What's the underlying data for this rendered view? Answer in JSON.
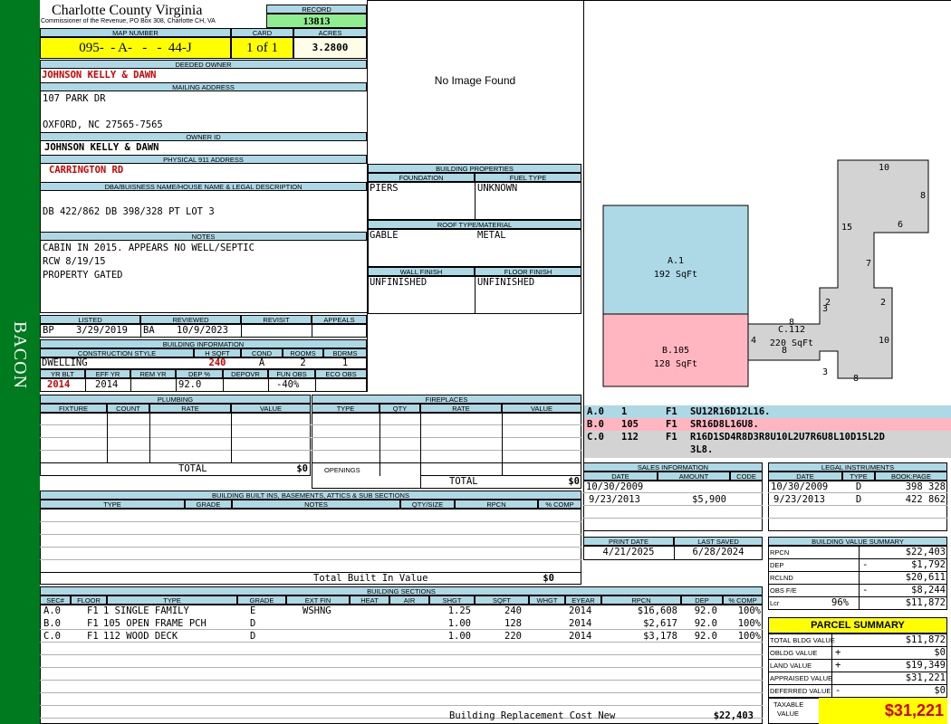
{
  "sidebar": {
    "label": "BACON",
    "color": "#007a1f"
  },
  "header": {
    "county": "Charlotte County Virginia",
    "commissioner": "Commissioner of the Revenue, PO Box 308, Charlotte CH, VA",
    "record_label": "RECORD",
    "record": "13813",
    "map_label": "MAP NUMBER",
    "map_number": "095-  - A-   -   -  44-J",
    "card_label": "CARD",
    "card": "1 of 1",
    "acres_label": "ACRES",
    "acres": "3.2800"
  },
  "owner": {
    "deeded_label": "DEEDED OWNER",
    "deeded": "JOHNSON KELLY & DAWN",
    "mailing_label": "MAILING ADDRESS",
    "mail1": "107 PARK DR",
    "mail2": "OXFORD, NC 27565-7565",
    "owner_id_label": "OWNER ID",
    "owner_id": "JOHNSON KELLY & DAWN",
    "phys_label": "PHYSICAL 911 ADDRESS",
    "phys": "CARRINGTON RD",
    "legal_label": "DBA/BUISNESS NAME/HOUSE NAME & LEGAL DESCRIPTION",
    "legal": "DB 422/862 DB 398/328 PT LOT 3",
    "notes_label": "NOTES",
    "notes": [
      "CABIN IN 2015.  APPEARS NO WELL/SEPTIC",
      "RCW 8/19/15",
      "PROPERTY GATED"
    ]
  },
  "listing": {
    "listed_label": "LISTED",
    "reviewed_label": "REVIEWED",
    "revisit_label": "REVISIT",
    "appeals_label": "APPEALS",
    "listed_by": "BP",
    "listed_date": "3/29/2019",
    "reviewed_by": "BA",
    "reviewed_date": "10/9/2023"
  },
  "building_info": {
    "title": "BUILDING INFORMATION",
    "h_style": "CONSTRUCTION STYLE",
    "h_sqft": "H SQFT",
    "h_cond": "COND",
    "h_rooms": "ROOMS",
    "h_bdrms": "BDRMS",
    "style": "DWELLING",
    "sqft": "240",
    "cond": "A",
    "rooms": "2",
    "bdrms": "1",
    "h_yrblt": "YR BLT",
    "h_effyr": "EFF YR",
    "h_remyr": "REM YR",
    "h_dep": "DEP %",
    "h_depovr": "DEPOVR",
    "h_funobs": "FUN OBS",
    "h_ecoobs": "ECO OBS",
    "yrblt": "2014",
    "effyr": "2014",
    "dep": "92.0",
    "funobs": "-40%"
  },
  "plumbing": {
    "title": "PLUMBING",
    "h_fixture": "FIXTURE",
    "h_count": "COUNT",
    "h_rate": "RATE",
    "h_value": "VALUE",
    "total_label": "TOTAL",
    "total": "$0"
  },
  "fireplaces": {
    "title": "FIREPLACES",
    "h_type": "TYPE",
    "h_qty": "QTY",
    "h_rate": "RATE",
    "h_value": "VALUE",
    "openings": "OPENINGS",
    "total_label": "TOTAL",
    "total": "$0"
  },
  "builtins": {
    "title": "BUILDING BUILT INS, BASEMENTS, ATTICS & SUB SECTIONS",
    "h_type": "TYPE",
    "h_grade": "GRADE",
    "h_notes": "NOTES",
    "h_qty": "QTY/SIZE",
    "h_rpcn": "RPCN",
    "h_comp": "% COMP",
    "total_label": "Total Built In Value",
    "total": "$0"
  },
  "sections": {
    "title": "BUILDING SECTIONS",
    "headers": [
      "SEC#",
      "FLOOR",
      "TYPE",
      "GRADE",
      "EXT FIN",
      "HEAT",
      "AIR",
      "SHGT",
      "SQFT",
      "WHGT",
      "EYEAR",
      "RPCN",
      "DEP",
      "% COMP"
    ],
    "rows": [
      [
        "A.0",
        "F1",
        "1 SINGLE FAMILY",
        "E",
        "WSHNG",
        "",
        "",
        "1.25",
        "240",
        "",
        "2014",
        "$16,608",
        "92.0",
        "100%"
      ],
      [
        "B.0",
        "F1",
        "105 OPEN FRAME PCH",
        "D",
        "",
        "",
        "",
        "1.00",
        "128",
        "",
        "2014",
        "$2,617",
        "92.0",
        "100%"
      ],
      [
        "C.0",
        "F1",
        "112 WOOD DECK",
        "D",
        "",
        "",
        "",
        "1.00",
        "220",
        "",
        "2014",
        "$3,178",
        "92.0",
        "100%"
      ]
    ],
    "rcn_label": "Building Replacement Cost New",
    "rcn": "$22,403"
  },
  "image": {
    "no_image": "No Image Found"
  },
  "building_props": {
    "title": "BUILDING PROPERTIES",
    "h_foundation": "FOUNDATION",
    "h_fuel": "FUEL TYPE",
    "foundation": "PIERS",
    "fuel": "UNKNOWN",
    "h_roof": "ROOF TYPE/MATERIAL",
    "roof1": "GABLE",
    "roof2": "METAL",
    "h_wall": "WALL FINISH",
    "h_floor": "FLOOR FINISH",
    "wall": "UNFINISHED",
    "floor": "UNFINISHED"
  },
  "sketch": {
    "a_label": "A.1",
    "a_area": "192 SqFt",
    "b_label": "B.105",
    "b_area": "128 SqFt",
    "c_label": "C.112",
    "c_area": "220 SqFt",
    "c_extra": "8",
    "dims": [
      "10",
      "8",
      "15",
      "6",
      "7",
      "2",
      "3",
      "2",
      "4",
      "10",
      "3",
      "8",
      "8"
    ],
    "a_color": "#add8e6",
    "b_color": "#ffb6c1",
    "c_color": "#d3d3d3"
  },
  "sketch_codes": [
    {
      "c1": "A.0",
      "c2": "1",
      "c3": "F1",
      "c4": "SU12R16D12L16.",
      "c5": "",
      "color": "#add8e6"
    },
    {
      "c1": "B.0",
      "c2": "105",
      "c3": "F1",
      "c4": "SR16D8L16U8.",
      "c5": "",
      "color": "#ffb6c1"
    },
    {
      "c1": "C.0",
      "c2": "112",
      "c3": "F1",
      "c4": "R16D1SD4R8D3R8U10L2U7R6U8L10D15L2D",
      "c5": "3L8.",
      "color": "#d3d3d3"
    }
  ],
  "sales": {
    "title": "SALES INFORMATION",
    "h_date": "DATE",
    "h_amount": "AMOUNT",
    "h_code": "CODE",
    "rows": [
      [
        "10/30/2009",
        "",
        ""
      ],
      [
        "9/23/2013",
        "$5,900",
        ""
      ]
    ]
  },
  "legal": {
    "title": "LEGAL INSTRUMENTS",
    "h_date": "DATE",
    "h_type": "TYPE",
    "h_book": "BOOK:PAGE",
    "rows": [
      [
        "10/30/2009",
        "D",
        "398 328"
      ],
      [
        "9/23/2013",
        "D",
        "422 862"
      ]
    ]
  },
  "dates": {
    "print_label": "PRINT DATE",
    "saved_label": "LAST SAVED",
    "print": "4/21/2025",
    "saved": "6/28/2024"
  },
  "value_summary": {
    "title": "BUILDING VALUE SUMMARY",
    "rows": [
      [
        "RPCN",
        "",
        "$22,403"
      ],
      [
        "DEP",
        "-",
        "$1,792"
      ],
      [
        "RCLND",
        "",
        "$20,611"
      ],
      [
        "OBS F/E",
        "-",
        "$8,244"
      ],
      [
        "Lcr",
        "96%",
        "$11,872"
      ]
    ]
  },
  "parcel": {
    "title": "PARCEL SUMMARY",
    "rows": [
      [
        "TOTAL BLDG VALUE",
        "",
        "$11,872"
      ],
      [
        "OBLDG VALUE",
        "+",
        "$0"
      ],
      [
        "LAND VALUE",
        "+",
        "$19,349"
      ],
      [
        "APPRAISED VALUE",
        "",
        "$31,221"
      ],
      [
        "DEFERRED VALUE",
        "-",
        "$0"
      ]
    ],
    "taxable_label1": "TAXABLE",
    "taxable_label2": "VALUE",
    "taxable": "$31,221",
    "accent": "#ffff00"
  }
}
